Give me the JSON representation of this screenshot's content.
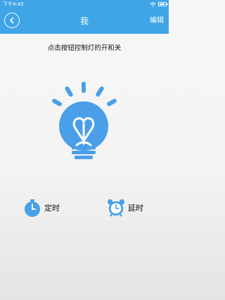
{
  "status_bar": {
    "time": "下午4:45"
  },
  "header": {
    "title": "我",
    "edit_label": "编辑"
  },
  "main": {
    "instruction": "点击按钮控制灯的开和关",
    "timer_label": "定时",
    "delay_label": "延时"
  },
  "colors": {
    "accent": "#3ea5e6",
    "icon_blue": "#4a9fe8",
    "background": "#f5f5f5"
  },
  "icons": [
    "back-icon",
    "light-bulb-icon",
    "stopwatch-icon",
    "alarm-clock-icon"
  ]
}
